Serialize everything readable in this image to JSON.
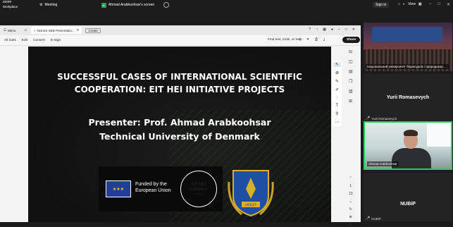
{
  "zoom": {
    "logo_line1": "zoom",
    "logo_line2": "Workplace",
    "meeting_tab": "Meeting",
    "share_tab": "Ahmad Arabkoohsar's screen",
    "signin": "Sign in",
    "view": "View"
  },
  "acrobat": {
    "menu": "Menu",
    "doc_tab": "NULES SEB Presentatio...",
    "create": "Create",
    "toolbar": [
      "All tools",
      "Edit",
      "Convert",
      "E-Sign"
    ],
    "find": "Find text, tools, or help",
    "share": "Share",
    "page_current": "1",
    "page_total": "13"
  },
  "slide": {
    "title_line1": "SUCCESSFUL CASES OF INTERNATIONAL SCIENTIFIC",
    "title_line2": "COOPERATION: EIT HEI INITIATIVE PROJECTS",
    "presenter_line1": "Presenter: Prof. Ahmad Arabkoohsar",
    "presenter_line2": "Technical University of Denmark",
    "eu_line1": "Funded by the",
    "eu_line2": "European Union",
    "eit_ring": "INNOVATION CAPACITY BUILDING FOR HIGHER EDUCATION",
    "eit_main1": "EIT HEI",
    "eit_main2": "Initiative",
    "eit_url": "eit-hei.eu",
    "crest_label": "НУБіП"
  },
  "participants": {
    "tile1_label": "Національний університет біоресурсів і природокористування",
    "tile2_name": "Yurii Romasevych",
    "tile2_small": "Yurii Romasevych",
    "tile3_label": "Ahmad Arabkoohsar",
    "tile4_name": "NUBiP",
    "tile4_small": "NUBiP"
  },
  "colors": {
    "active_speaker": "#23d160",
    "zoom_bg": "#1b1b1b",
    "share_green": "#23a559"
  }
}
